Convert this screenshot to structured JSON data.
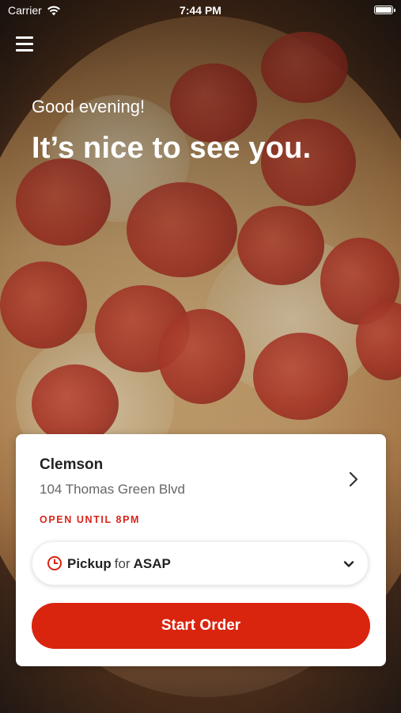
{
  "status_bar": {
    "carrier": "Carrier",
    "time": "7:44 PM"
  },
  "hero": {
    "greeting": "Good evening!",
    "headline": "It’s nice to see you."
  },
  "store": {
    "name": "Clemson",
    "address": "104 Thomas Green Blvd",
    "hours": "OPEN UNTIL 8PM"
  },
  "order_mode": {
    "mode": "Pickup",
    "connector": "for",
    "time": "ASAP"
  },
  "actions": {
    "start_order": "Start Order"
  },
  "colors": {
    "accent": "#d9240e",
    "hours_text": "#d9241a",
    "card_bg": "#ffffff"
  },
  "icons": {
    "menu": "hamburger-menu-icon",
    "wifi": "wifi-icon",
    "battery": "battery-icon",
    "store_chevron": "chevron-right-icon",
    "clock": "clock-icon",
    "dropdown": "chevron-down-icon"
  }
}
